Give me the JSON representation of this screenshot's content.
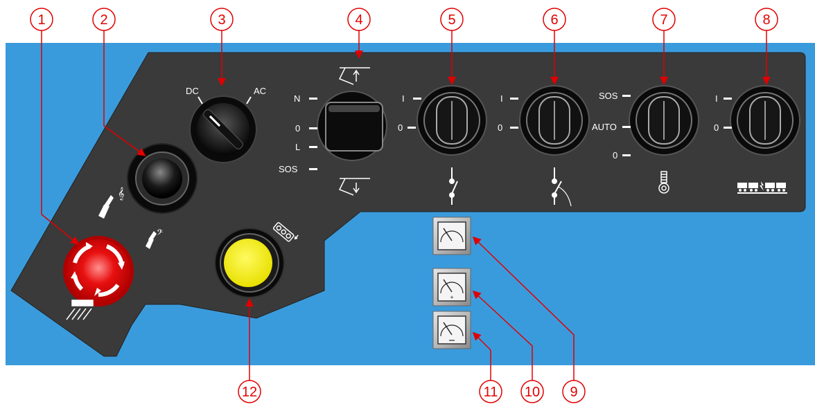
{
  "callouts": [
    "1",
    "2",
    "3",
    "4",
    "5",
    "6",
    "7",
    "8",
    "9",
    "10",
    "11",
    "12"
  ],
  "switch_dcac": {
    "left": "DC",
    "right": "AC"
  },
  "switch4": {
    "n": "N",
    "zero": "0",
    "l": "L",
    "sos": "SOS"
  },
  "switch5": {
    "one": "I",
    "zero": "0"
  },
  "switch6": {
    "one": "I",
    "zero": "0"
  },
  "switch7": {
    "sos": "SOS",
    "auto": "AUTO",
    "zero": "0"
  },
  "switch8": {
    "one": "I",
    "zero": "0"
  },
  "colors": {
    "background": "#3a9bdc",
    "panel": "#3a3a3a",
    "callout": "#e00000",
    "emergency": "#e00000",
    "button_yellow": "#f5f000"
  },
  "icons": [
    "horn-high-icon",
    "horn-low-icon",
    "emergency-brake-icon",
    "pantograph-up-icon",
    "pantograph-down-icon",
    "switch-open-icon",
    "switch-breaker-icon",
    "heater-icon",
    "train-coupling-icon",
    "sanding-icon",
    "voltmeter-icon",
    "ammeter-plus-icon",
    "ammeter-minus-icon"
  ]
}
